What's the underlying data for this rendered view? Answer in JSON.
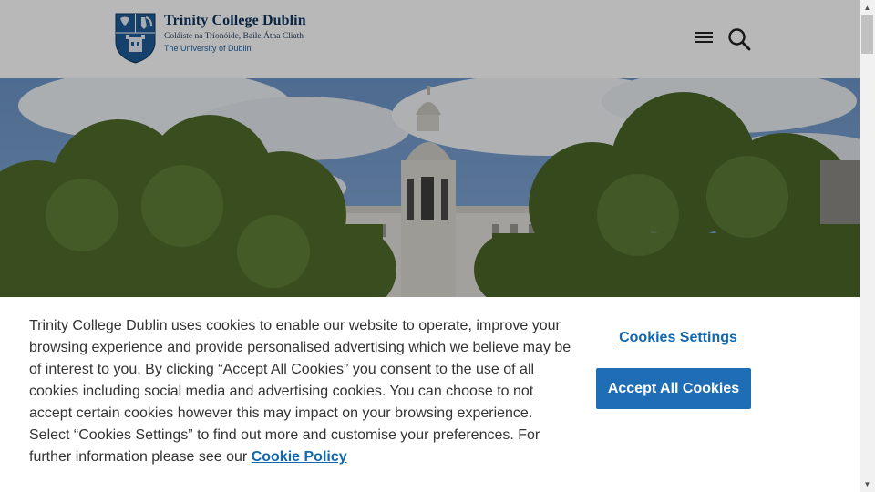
{
  "header": {
    "logo": {
      "name": "Trinity College Dublin",
      "irish_name": "Coláiste na Tríonóide, Baile Átha Cliath",
      "subtitle": "The University of Dublin"
    },
    "menu_icon": "hamburger-menu-icon",
    "search_icon": "search-icon"
  },
  "cookie_banner": {
    "text": "Trinity College Dublin uses cookies to enable our website to operate, improve your browsing experience and provide personalised advertising which we believe may be of interest to you. By clicking “Accept All Cookies” you consent to the use of all cookies including social media and advertising cookies. You can choose to not accept certain cookies however this may impact on your browsing experience. Select “Cookies Settings” to find out more and customise your preferences. For further information please see our",
    "policy_link": "Cookie Policy",
    "settings_label": "Cookies Settings",
    "accept_label": "Accept All Cookies"
  },
  "colors": {
    "brand_navy": "#0f3560",
    "link_blue": "#0f67b1",
    "button_blue": "#1f6db5"
  }
}
